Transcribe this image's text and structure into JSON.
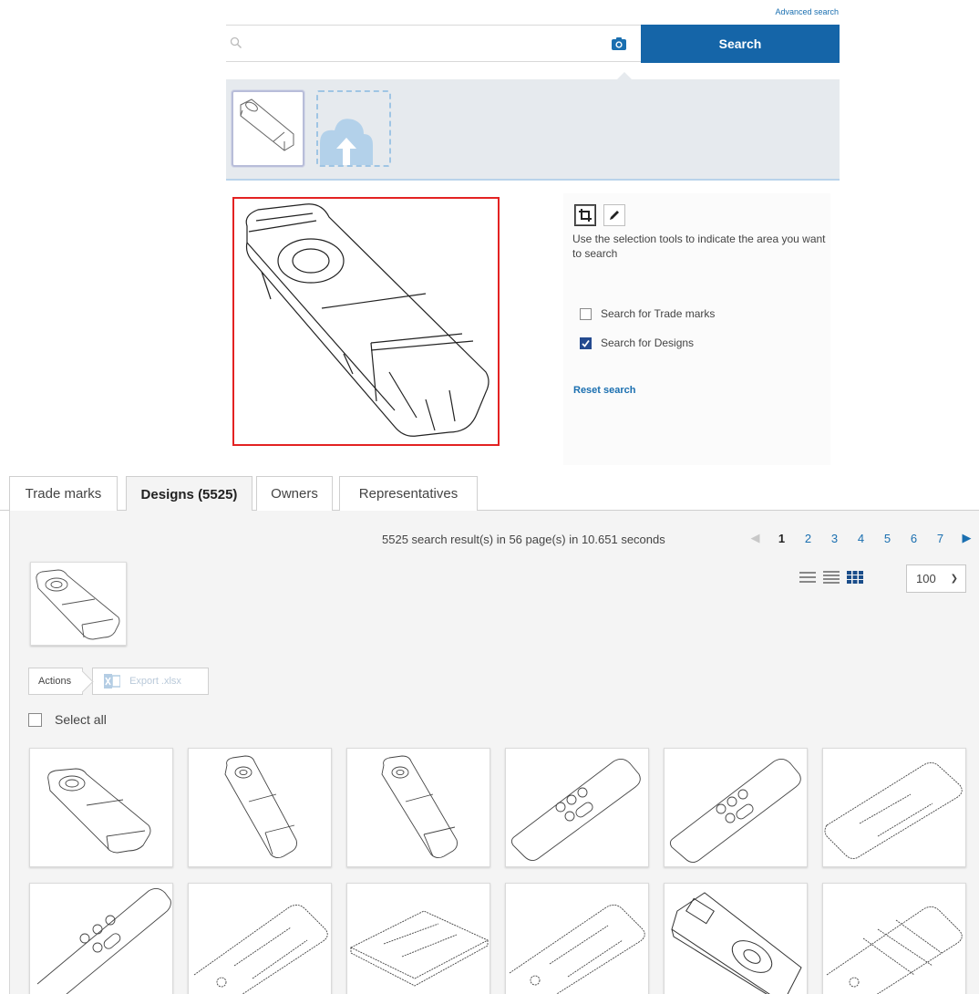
{
  "search": {
    "advanced_link": "Advanced search",
    "query_value": "",
    "button_label": "Search"
  },
  "tools": {
    "help_text": "Use the selection tools to indicate the area you want to search",
    "trademarks_label": "Search for Trade marks",
    "trademarks_checked": false,
    "designs_label": "Search for Designs",
    "designs_checked": true,
    "reset_label": "Reset search"
  },
  "tabs": [
    {
      "label": "Trade marks",
      "active": false
    },
    {
      "label": "Designs (5525)",
      "active": true
    },
    {
      "label": "Owners",
      "active": false
    },
    {
      "label": "Representatives",
      "active": false
    }
  ],
  "results": {
    "summary": "5525 search result(s) in 56 page(s) in 10.651 seconds",
    "pages": [
      "1",
      "2",
      "3",
      "4",
      "5",
      "6",
      "7"
    ],
    "current_page": "1",
    "per_page": "100",
    "actions_label": "Actions",
    "export_label": "Export .xlsx",
    "select_all_label": "Select all"
  },
  "colors": {
    "accent": "#1565a8",
    "selection_border": "#e32222",
    "checkbox_on": "#244a8f"
  }
}
